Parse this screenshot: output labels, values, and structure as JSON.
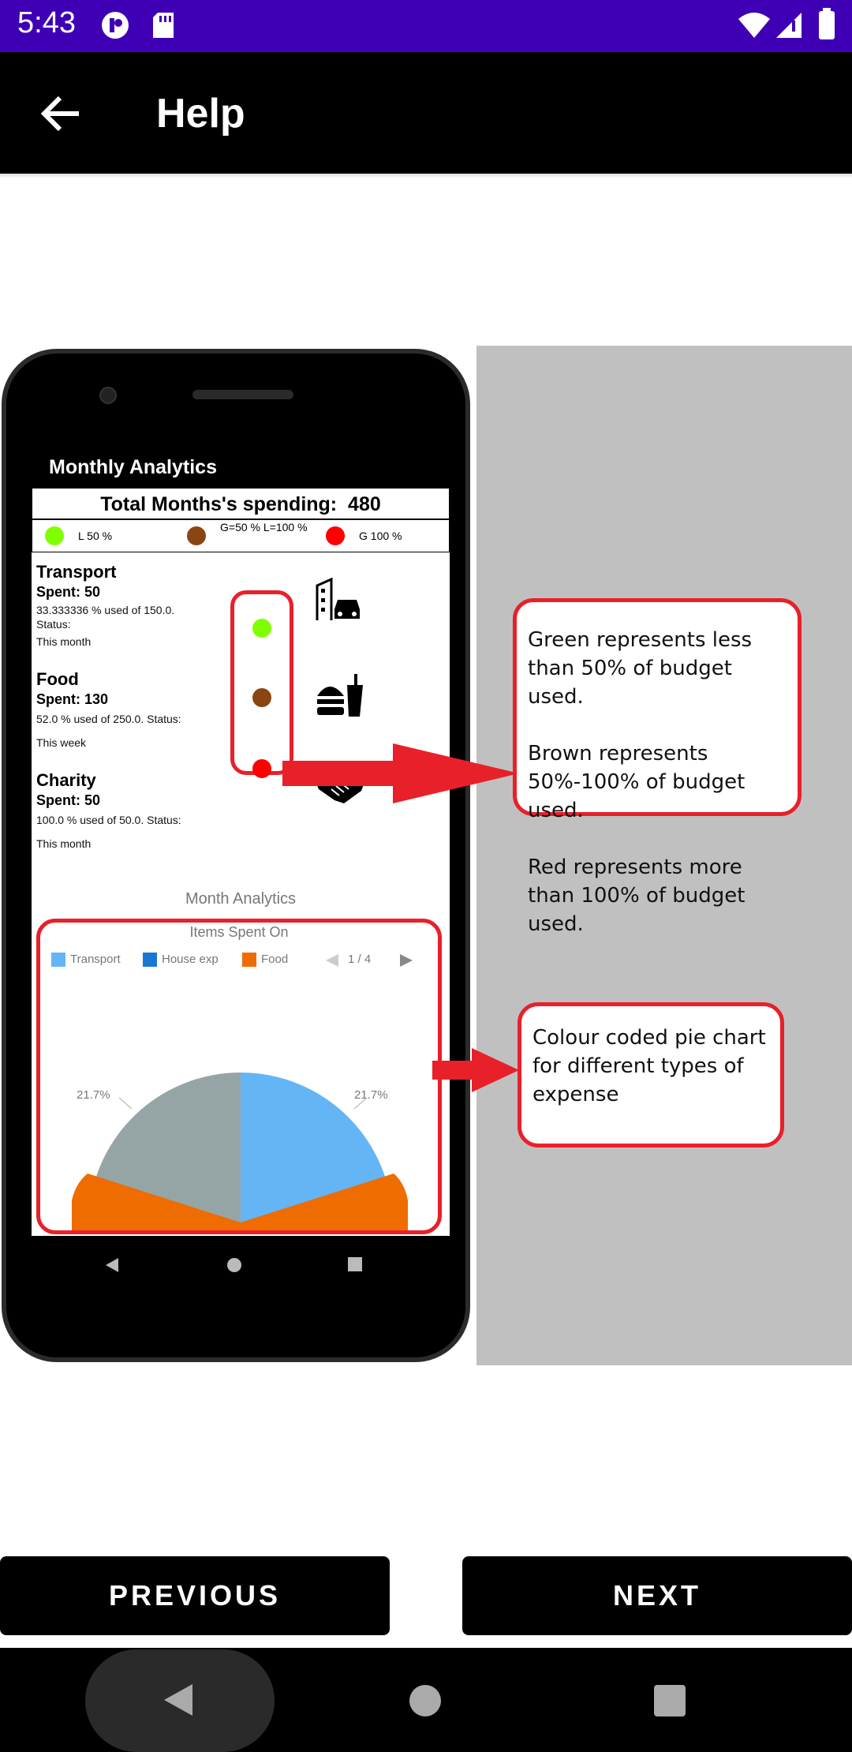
{
  "status_bar": {
    "time": "5:43",
    "icons": [
      "app-icon",
      "sd-card-icon",
      "wifi-icon",
      "signal-icon",
      "battery-icon"
    ]
  },
  "app_bar": {
    "title": "Help",
    "back_icon": "arrow-left-icon"
  },
  "illustration": {
    "phone": {
      "screen_title": "Monthly Analytics",
      "total_label": "Total Months's spending:",
      "total_value": "480",
      "legend": {
        "green": "L 50 %",
        "brown": "G=50 % L=100 %",
        "red": "G 100 %"
      },
      "categories": [
        {
          "name": "Transport",
          "spent": "Spent: 50",
          "detail": "33.333336 % used of 150.0. Status:",
          "period": "This month",
          "status_color": "#7fff00",
          "icon": "building-car-icon"
        },
        {
          "name": "Food",
          "spent": "Spent: 130",
          "detail": "52.0 % used of 250.0. Status:",
          "period": "This week",
          "status_color": "#8b4513",
          "icon": "fast-food-icon"
        },
        {
          "name": "Charity",
          "spent": "Spent: 50",
          "detail": "100.0 % used of 50.0. Status:",
          "period": "This month",
          "status_color": "#ff0000",
          "icon": "handshake-icon"
        }
      ],
      "month_analytics_label": "Month Analytics",
      "pie_title": "Items Spent On",
      "pie_legend": [
        {
          "label": "Transport",
          "color": "#64b5f6"
        },
        {
          "label": "House exp",
          "color": "#1976d2"
        },
        {
          "label": "Food",
          "color": "#ef6c00"
        }
      ],
      "pie_page": "1 / 4",
      "pie_labels": [
        "21.7%",
        "21.7%"
      ]
    },
    "callouts": {
      "status_lines": [
        "Green represents less than 50% of budget used.",
        "Brown represents 50%-100% of budget used.",
        "Red represents more than 100% of budget used."
      ],
      "pie_text": "Colour coded pie chart for different types of expense"
    }
  },
  "buttons": {
    "previous": "PREVIOUS",
    "next": "NEXT"
  },
  "nav_bar": {
    "icons": [
      "back-icon",
      "home-icon",
      "recents-icon"
    ]
  }
}
